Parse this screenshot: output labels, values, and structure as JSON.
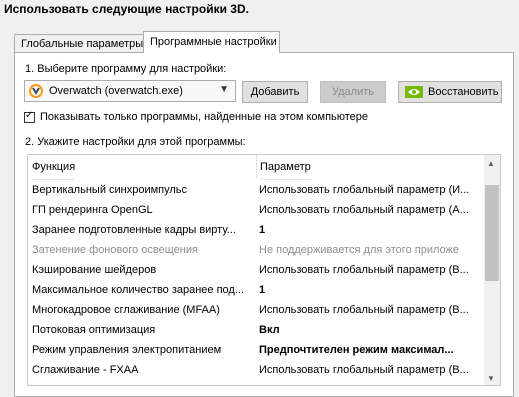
{
  "page_title": "Использовать следующие настройки 3D.",
  "tabs": [
    {
      "label": "Глобальные параметры",
      "active": false
    },
    {
      "label": "Программные настройки",
      "active": true
    }
  ],
  "step1_label": "1. Выберите программу для настройки:",
  "program_select": {
    "value": "Overwatch (overwatch.exe)",
    "icon": "overwatch-icon"
  },
  "buttons": {
    "add": "Добавить",
    "remove": "Удалить",
    "restore": "Восстановить"
  },
  "checkbox": {
    "label": "Показывать только программы, найденные на этом компьютере",
    "checked": true
  },
  "step2_label": "2. Укажите настройки для этой программы:",
  "table": {
    "columns": [
      "Функция",
      "Параметр"
    ],
    "rows": [
      {
        "function": "Вертикальный синхроимпульс",
        "value": "Использовать глобальный параметр (И..."
      },
      {
        "function": "ГП рендеринга OpenGL",
        "value": "Использовать глобальный параметр (А..."
      },
      {
        "function": "Заранее подготовленные кадры вирту...",
        "value": "1",
        "bold": true
      },
      {
        "function": "Затенение фонового освещения",
        "value": "Не поддерживается для этого приложе",
        "disabled": true
      },
      {
        "function": "Кэширование шейдеров",
        "value": "Использовать глобальный параметр (В..."
      },
      {
        "function": "Максимальное количество заранее под...",
        "value": "1",
        "bold": true
      },
      {
        "function": "Многокадровое сглаживание (MFAA)",
        "value": "Использовать глобальный параметр (В..."
      },
      {
        "function": "Потоковая оптимизация",
        "value": "Вкл",
        "bold": true
      },
      {
        "function": "Режим управления электропитанием",
        "value": "Предпочтителен режим максимал...",
        "bold": true
      },
      {
        "function": "Сглаживание - FXAA",
        "value": "Использовать глобальный параметр (В..."
      }
    ]
  }
}
